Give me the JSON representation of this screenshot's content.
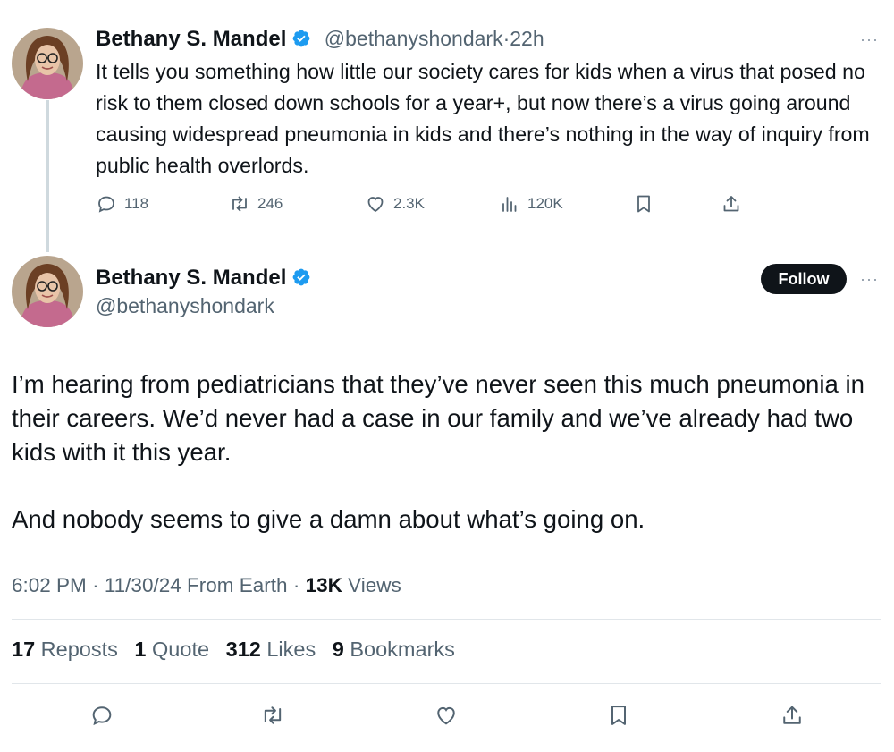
{
  "reply_to": {
    "author_name": "Bethany S. Mandel",
    "handle": "@bethanyshondark",
    "separator": "·",
    "time": "22h",
    "more": "···",
    "text": "It tells you something how little our society cares for kids when a virus that posed no risk to them closed down schools for a year+, but now there’s a virus going around causing widespread pneumonia in kids and there’s nothing in the way of inquiry from public health overlords.",
    "actions": {
      "replies": "118",
      "reposts": "246",
      "likes": "2.3K",
      "views": "120K"
    }
  },
  "main_tweet": {
    "author_name": "Bethany S. Mandel",
    "handle": "@bethanyshondark",
    "follow_label": "Follow",
    "more": "···",
    "paragraph1": "I’m hearing from pediatricians that they’ve never seen this much pneumonia in their careers. We’d never had a case in our family and we’ve already had two kids with it this year.",
    "paragraph2": "And nobody seems to give a damn about what’s going on.",
    "meta": {
      "time": "6:02 PM",
      "sep1": "·",
      "date": "11/30/24",
      "source": "From Earth",
      "sep2": "·",
      "views_count": "13K",
      "views_label": "Views"
    },
    "stats": {
      "reposts_count": "17",
      "reposts_label": "Reposts",
      "quotes_count": "1",
      "quotes_label": "Quote",
      "likes_count": "312",
      "likes_label": "Likes",
      "bookmarks_count": "9",
      "bookmarks_label": "Bookmarks"
    }
  },
  "colors": {
    "text_primary": "#0f1419",
    "text_secondary": "#536471",
    "verified_blue": "#1d9bf0",
    "divider": "#e1e6ea",
    "follow_bg": "#0f1419"
  }
}
